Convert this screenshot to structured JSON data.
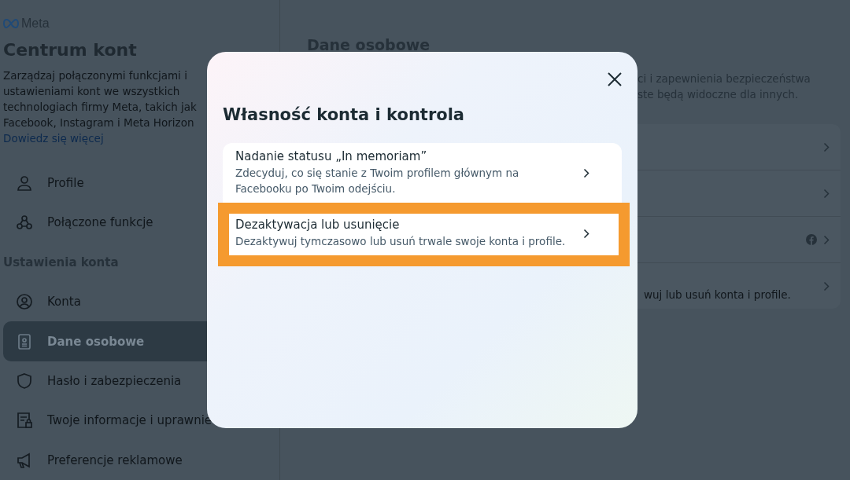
{
  "sidebar": {
    "brand": "Meta",
    "title": "Centrum kont",
    "description_lines": [
      "Zarządzaj połączonymi funkcjami i",
      "ustawieniami kont we wszystkich",
      "technologiach firmy Meta, takich jak",
      "Facebook, Instagram i Meta Horizon"
    ],
    "link": "Dowiedz się więcej",
    "groups": [
      {
        "items": [
          {
            "label": "Profile",
            "selected": false
          },
          {
            "label": "Połączone funkcje",
            "selected": false
          }
        ]
      },
      {
        "heading": "Ustawienia konta",
        "items": [
          {
            "label": "Konta",
            "selected": false
          },
          {
            "label": "Dane osobowe",
            "selected": true
          },
          {
            "label": "Hasło i zabezpieczenia",
            "selected": false
          },
          {
            "label": "Twoje informacje i uprawnie",
            "selected": false
          },
          {
            "label": "Preferencje reklamowe",
            "selected": false
          }
        ]
      }
    ]
  },
  "main": {
    "title": "Dane osobowe",
    "description_lines": [
      "ci i zapewnienia bezpieczeństwa",
      "ste będą widoczne dla innych."
    ],
    "rows": [
      {
        "badge": false
      },
      {
        "badge": false
      },
      {
        "badge": true
      },
      {
        "text": "wuj lub usuń konta i profile.",
        "badge": false
      }
    ]
  },
  "dialog": {
    "title": "Własność konta i kontrola",
    "options": [
      {
        "title": "Nadanie statusu „In memoriam”",
        "description": "Zdecyduj, co się stanie z Twoim profilem głównym na Facebooku po Twoim odejściu.",
        "highlighted": false
      },
      {
        "title": "Dezaktywacja lub usunięcie",
        "description": "Dezaktywuj tymczasowo lub usuń trwale swoje konta i profile.",
        "highlighted": true
      }
    ]
  }
}
